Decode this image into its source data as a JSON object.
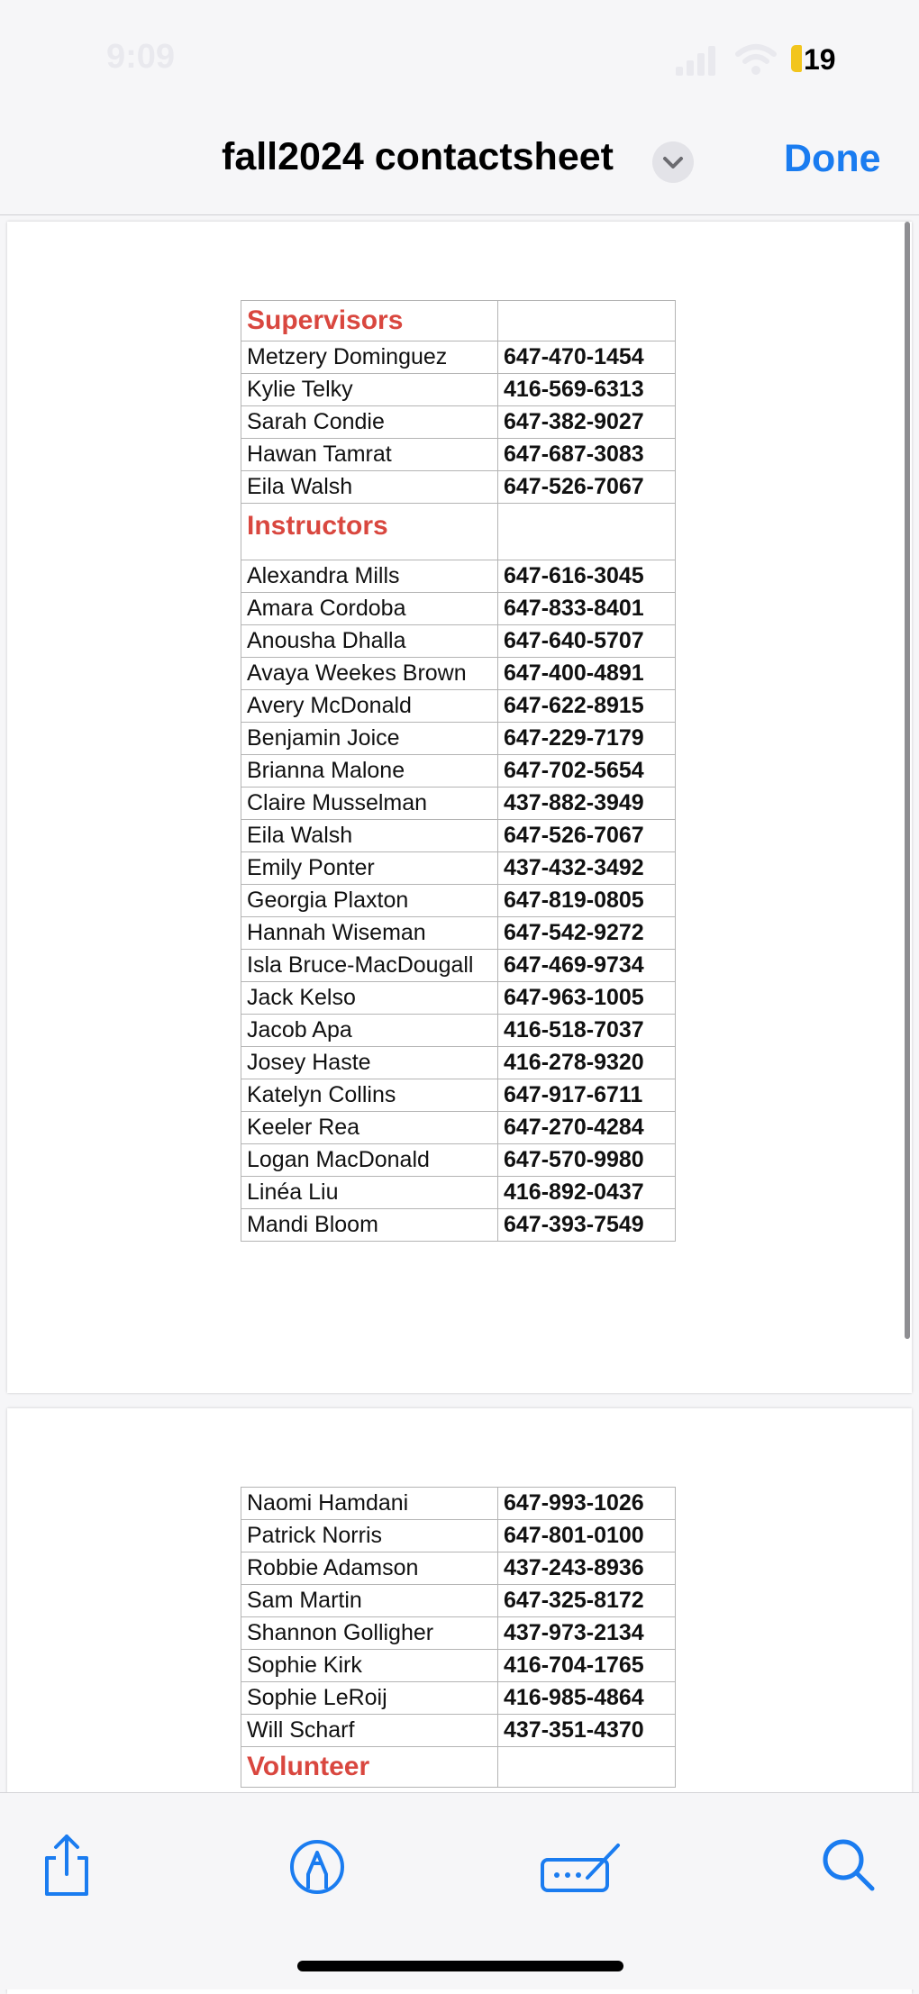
{
  "status": {
    "time": "9:09",
    "battery": "19"
  },
  "nav": {
    "title": "fall2024 contactsheet",
    "done_label": "Done"
  },
  "page1": {
    "supervisors_heading": "Supervisors",
    "supervisors": [
      {
        "name": "Metzery Dominguez",
        "phone": "647-470-1454"
      },
      {
        "name": "Kylie Telky",
        "phone": "416-569-6313"
      },
      {
        "name": "Sarah Condie",
        "phone": "647-382-9027"
      },
      {
        "name": "Hawan Tamrat",
        "phone": "647-687-3083"
      },
      {
        "name": "Eila Walsh",
        "phone": "647-526-7067"
      }
    ],
    "instructors_heading": "Instructors",
    "instructors": [
      {
        "name": "Alexandra Mills",
        "phone": "647-616-3045"
      },
      {
        "name": "Amara Cordoba",
        "phone": "647-833-8401"
      },
      {
        "name": "Anousha Dhalla",
        "phone": "647-640-5707"
      },
      {
        "name": "Avaya Weekes Brown",
        "phone": "647-400-4891"
      },
      {
        "name": "Avery McDonald",
        "phone": "647-622-8915"
      },
      {
        "name": "Benjamin Joice",
        "phone": "647-229-7179"
      },
      {
        "name": "Brianna Malone",
        "phone": "647-702-5654"
      },
      {
        "name": "Claire Musselman",
        "phone": "437-882-3949"
      },
      {
        "name": "Eila Walsh",
        "phone": "647-526-7067"
      },
      {
        "name": "Emily Ponter",
        "phone": "437-432-3492"
      },
      {
        "name": "Georgia Plaxton",
        "phone": "647-819-0805"
      },
      {
        "name": "Hannah Wiseman",
        "phone": "647-542-9272"
      },
      {
        "name": "Isla Bruce-MacDougall",
        "phone": "647-469-9734"
      },
      {
        "name": "Jack Kelso",
        "phone": "647-963-1005"
      },
      {
        "name": "Jacob Apa",
        "phone": "416-518-7037"
      },
      {
        "name": "Josey Haste",
        "phone": "416-278-9320"
      },
      {
        "name": "Katelyn Collins",
        "phone": "647-917-6711"
      },
      {
        "name": "Keeler Rea",
        "phone": "647-270-4284"
      },
      {
        "name": "Logan MacDonald",
        "phone": "647-570-9980"
      },
      {
        "name": "Linéa Liu",
        "phone": "416-892-0437"
      },
      {
        "name": "Mandi Bloom",
        "phone": "647-393-7549"
      }
    ]
  },
  "page2": {
    "instructors_cont": [
      {
        "name": "Naomi Hamdani",
        "phone": "647-993-1026"
      },
      {
        "name": "Patrick Norris",
        "phone": "647-801-0100"
      },
      {
        "name": "Robbie Adamson",
        "phone": "437-243-8936"
      },
      {
        "name": "Sam Martin",
        "phone": "647-325-8172"
      },
      {
        "name": "Shannon Golligher",
        "phone": "437-973-2134"
      },
      {
        "name": "Sophie Kirk",
        "phone": "416-704-1765"
      },
      {
        "name": "Sophie LeRoij",
        "phone": "416-985-4864"
      },
      {
        "name": "Will Scharf",
        "phone": "437-351-4370"
      }
    ],
    "volunteer_heading": "Volunteer"
  },
  "toolbar": {
    "share_icon": "share-icon",
    "markup_icon": "markup-pen-icon",
    "signature_icon": "signature-icon",
    "search_icon": "search-icon",
    "accent": "#1a7cf0"
  }
}
